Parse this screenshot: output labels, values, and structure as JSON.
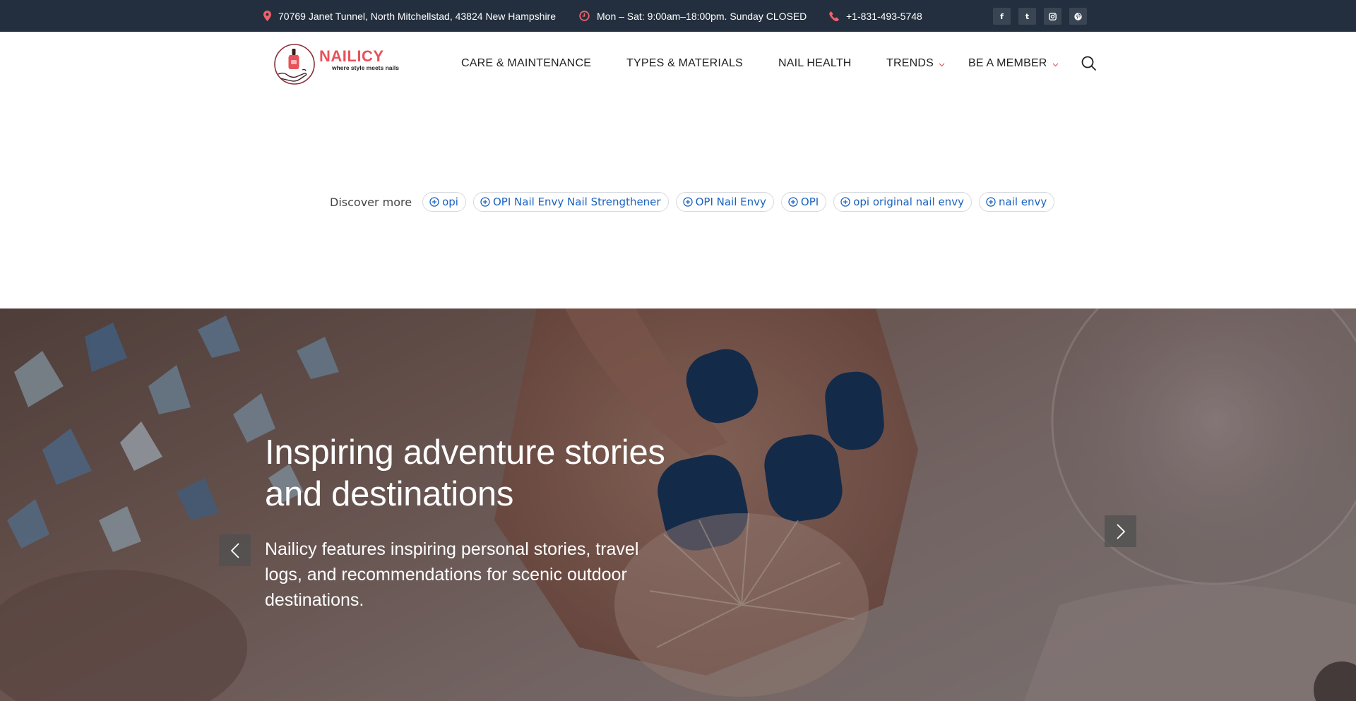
{
  "topbar": {
    "address": "70769 Janet Tunnel, North Mitchellstad, 43824 New Hampshire",
    "hours": "Mon – Sat: 9:00am–18:00pm. Sunday CLOSED",
    "phone": "+1-831-493-5748",
    "social": [
      {
        "icon": "facebook-icon",
        "glyph": "f"
      },
      {
        "icon": "twitter-icon",
        "glyph": "t"
      },
      {
        "icon": "instagram-icon",
        "glyph": "◎"
      },
      {
        "icon": "pinterest-icon",
        "glyph": "℗"
      }
    ]
  },
  "logo": {
    "name": "NAILICY",
    "tagline": "where style meets nails"
  },
  "nav": {
    "items": [
      {
        "label": "CARE & MAINTENANCE",
        "dropdown": false
      },
      {
        "label": "TYPES & MATERIALS",
        "dropdown": false
      },
      {
        "label": "NAIL HEALTH",
        "dropdown": false
      },
      {
        "label": "TRENDS",
        "dropdown": true
      },
      {
        "label": "BE A MEMBER",
        "dropdown": true
      }
    ]
  },
  "discover": {
    "label": "Discover more",
    "chips": [
      "opi",
      "OPI Nail Envy Nail Strengthener",
      "OPI Nail Envy",
      "OPI",
      "opi original nail envy",
      "nail envy"
    ]
  },
  "hero": {
    "title": "Inspiring adventure stories and destinations",
    "text": "Nailicy features inspiring personal stories, travel logs, and recommendations for scenic outdoor destinations."
  },
  "colors": {
    "topbar_bg": "#232f3e",
    "accent": "#e8525a",
    "chip_text": "#1a62c0"
  }
}
